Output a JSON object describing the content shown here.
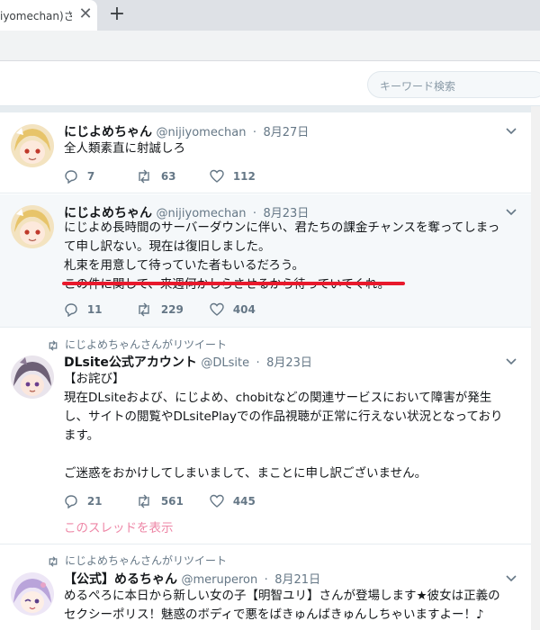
{
  "browser": {
    "tab_title": "iyomechan)さん",
    "tab_close": "✕",
    "new_tab": "+"
  },
  "search": {
    "placeholder": "キーワード検索"
  },
  "tweets": [
    {
      "name": "にじよめちゃん",
      "handle": "@nijiyomechan",
      "date": "8月27日",
      "lines": [
        "全人類素直に射誠しろ"
      ],
      "replies": "7",
      "retweets": "63",
      "likes": "112"
    },
    {
      "name": "にじよめちゃん",
      "handle": "@nijiyomechan",
      "date": "8月23日",
      "lines": [
        "にじよめ長時間のサーバーダウンに伴い、君たちの課金チャンスを奪ってしまっ",
        "て申し訳ない。現在は復旧しました。",
        "札束を用意して待っていた者もいるだろう。",
        "この件に関して、来週何かしらさせるから待っていてくれ。"
      ],
      "replies": "11",
      "retweets": "229",
      "likes": "404"
    },
    {
      "retweet_note": "にじよめちゃんさんがリツイート",
      "name": "DLsite公式アカウント",
      "handle": "@DLsite",
      "date": "8月23日",
      "lines": [
        "【お詫び】",
        "現在DLsiteおよび、にじよめ、chobitなどの関連サービスにおいて障害が発生",
        "し、サイトの閲覧やDLsitePlayでの作品視聴が正常に行えない状況となっており",
        "ます。",
        "",
        "ご迷惑をおかけしてしまいまして、まことに申し訳ございません。"
      ],
      "replies": "21",
      "retweets": "561",
      "likes": "445",
      "thread_link": "このスレッドを表示"
    },
    {
      "retweet_note": "にじよめちゃんさんがリツイート",
      "name": "【公式】めるちゃん",
      "handle": "@meruperon",
      "date": "8月21日",
      "lines": [
        "めるぺろに本日から新しい女の子【明智ユリ】さんが登場します★彼女は正義の",
        "セクシーポリス！魅惑のボディで悪をばきゅんばきゅんしちゃいますよー！♪"
      ]
    }
  ],
  "colors": {
    "accent_red": "#e8192c",
    "highlight_bg": "#f5f8fa",
    "link_pink": "#e0245e"
  }
}
